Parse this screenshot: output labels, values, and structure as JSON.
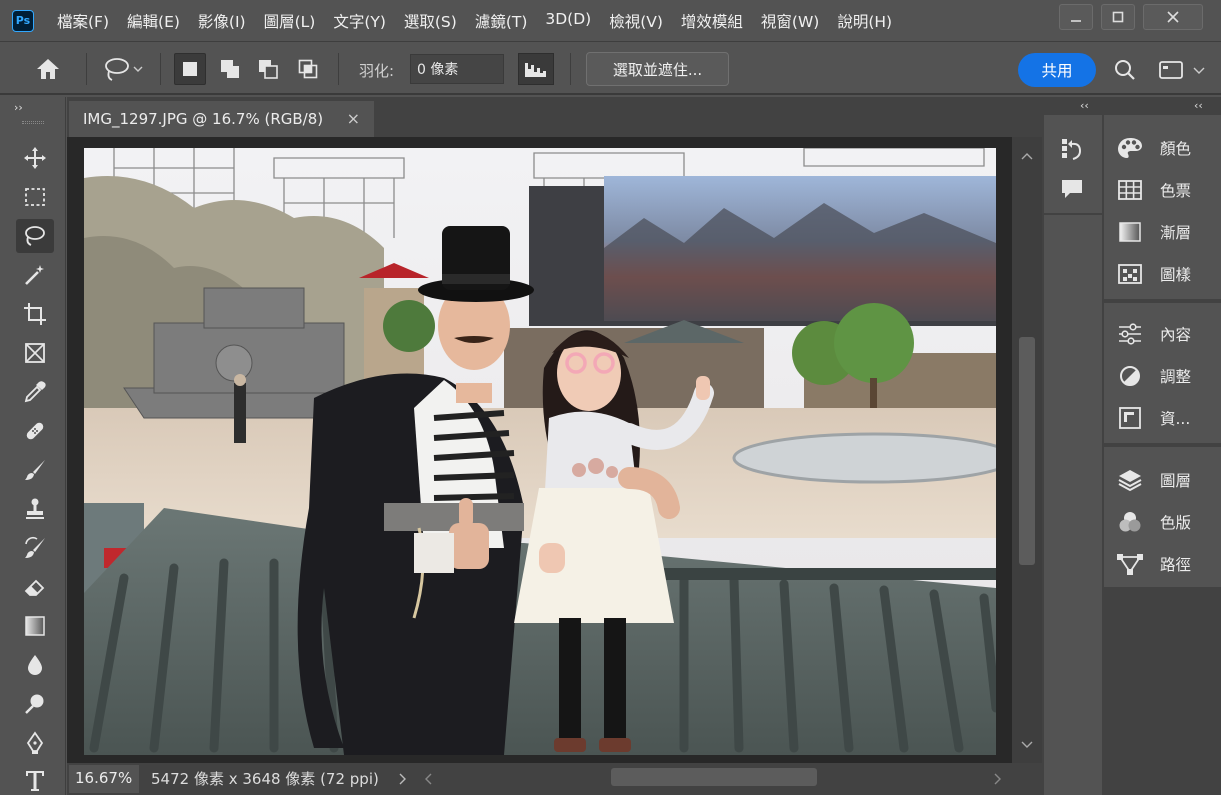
{
  "app": {
    "logo": "Ps",
    "menu": [
      "檔案(F)",
      "編輯(E)",
      "影像(I)",
      "圖層(L)",
      "文字(Y)",
      "選取(S)",
      "濾鏡(T)",
      "3D(D)",
      "檢視(V)",
      "增效模組",
      "視窗(W)",
      "說明(H)"
    ]
  },
  "options": {
    "feather_label": "羽化:",
    "feather_value": "0 像素",
    "select_mask": "選取並遮住...",
    "share": "共用"
  },
  "document": {
    "tab_title": "IMG_1297.JPG @ 16.7% (RGB/8)",
    "tab_close": "×",
    "zoom": "16.67%",
    "info": "5472 像素 x 3648 像素 (72 ppi)"
  },
  "panels": {
    "group1": [
      "顏色",
      "色票",
      "漸層",
      "圖樣"
    ],
    "group2": [
      "內容",
      "調整",
      "資..."
    ],
    "group3": [
      "圖層",
      "色版",
      "路徑"
    ]
  },
  "icons": {
    "home": "home-icon",
    "lasso": "lasso-icon",
    "search": "search-icon",
    "workspace": "workspace-icon"
  },
  "colors": {
    "accent": "#1473e6",
    "ui_bg": "#535353",
    "panel_dark": "#424242",
    "canvas_bg": "#282828"
  }
}
